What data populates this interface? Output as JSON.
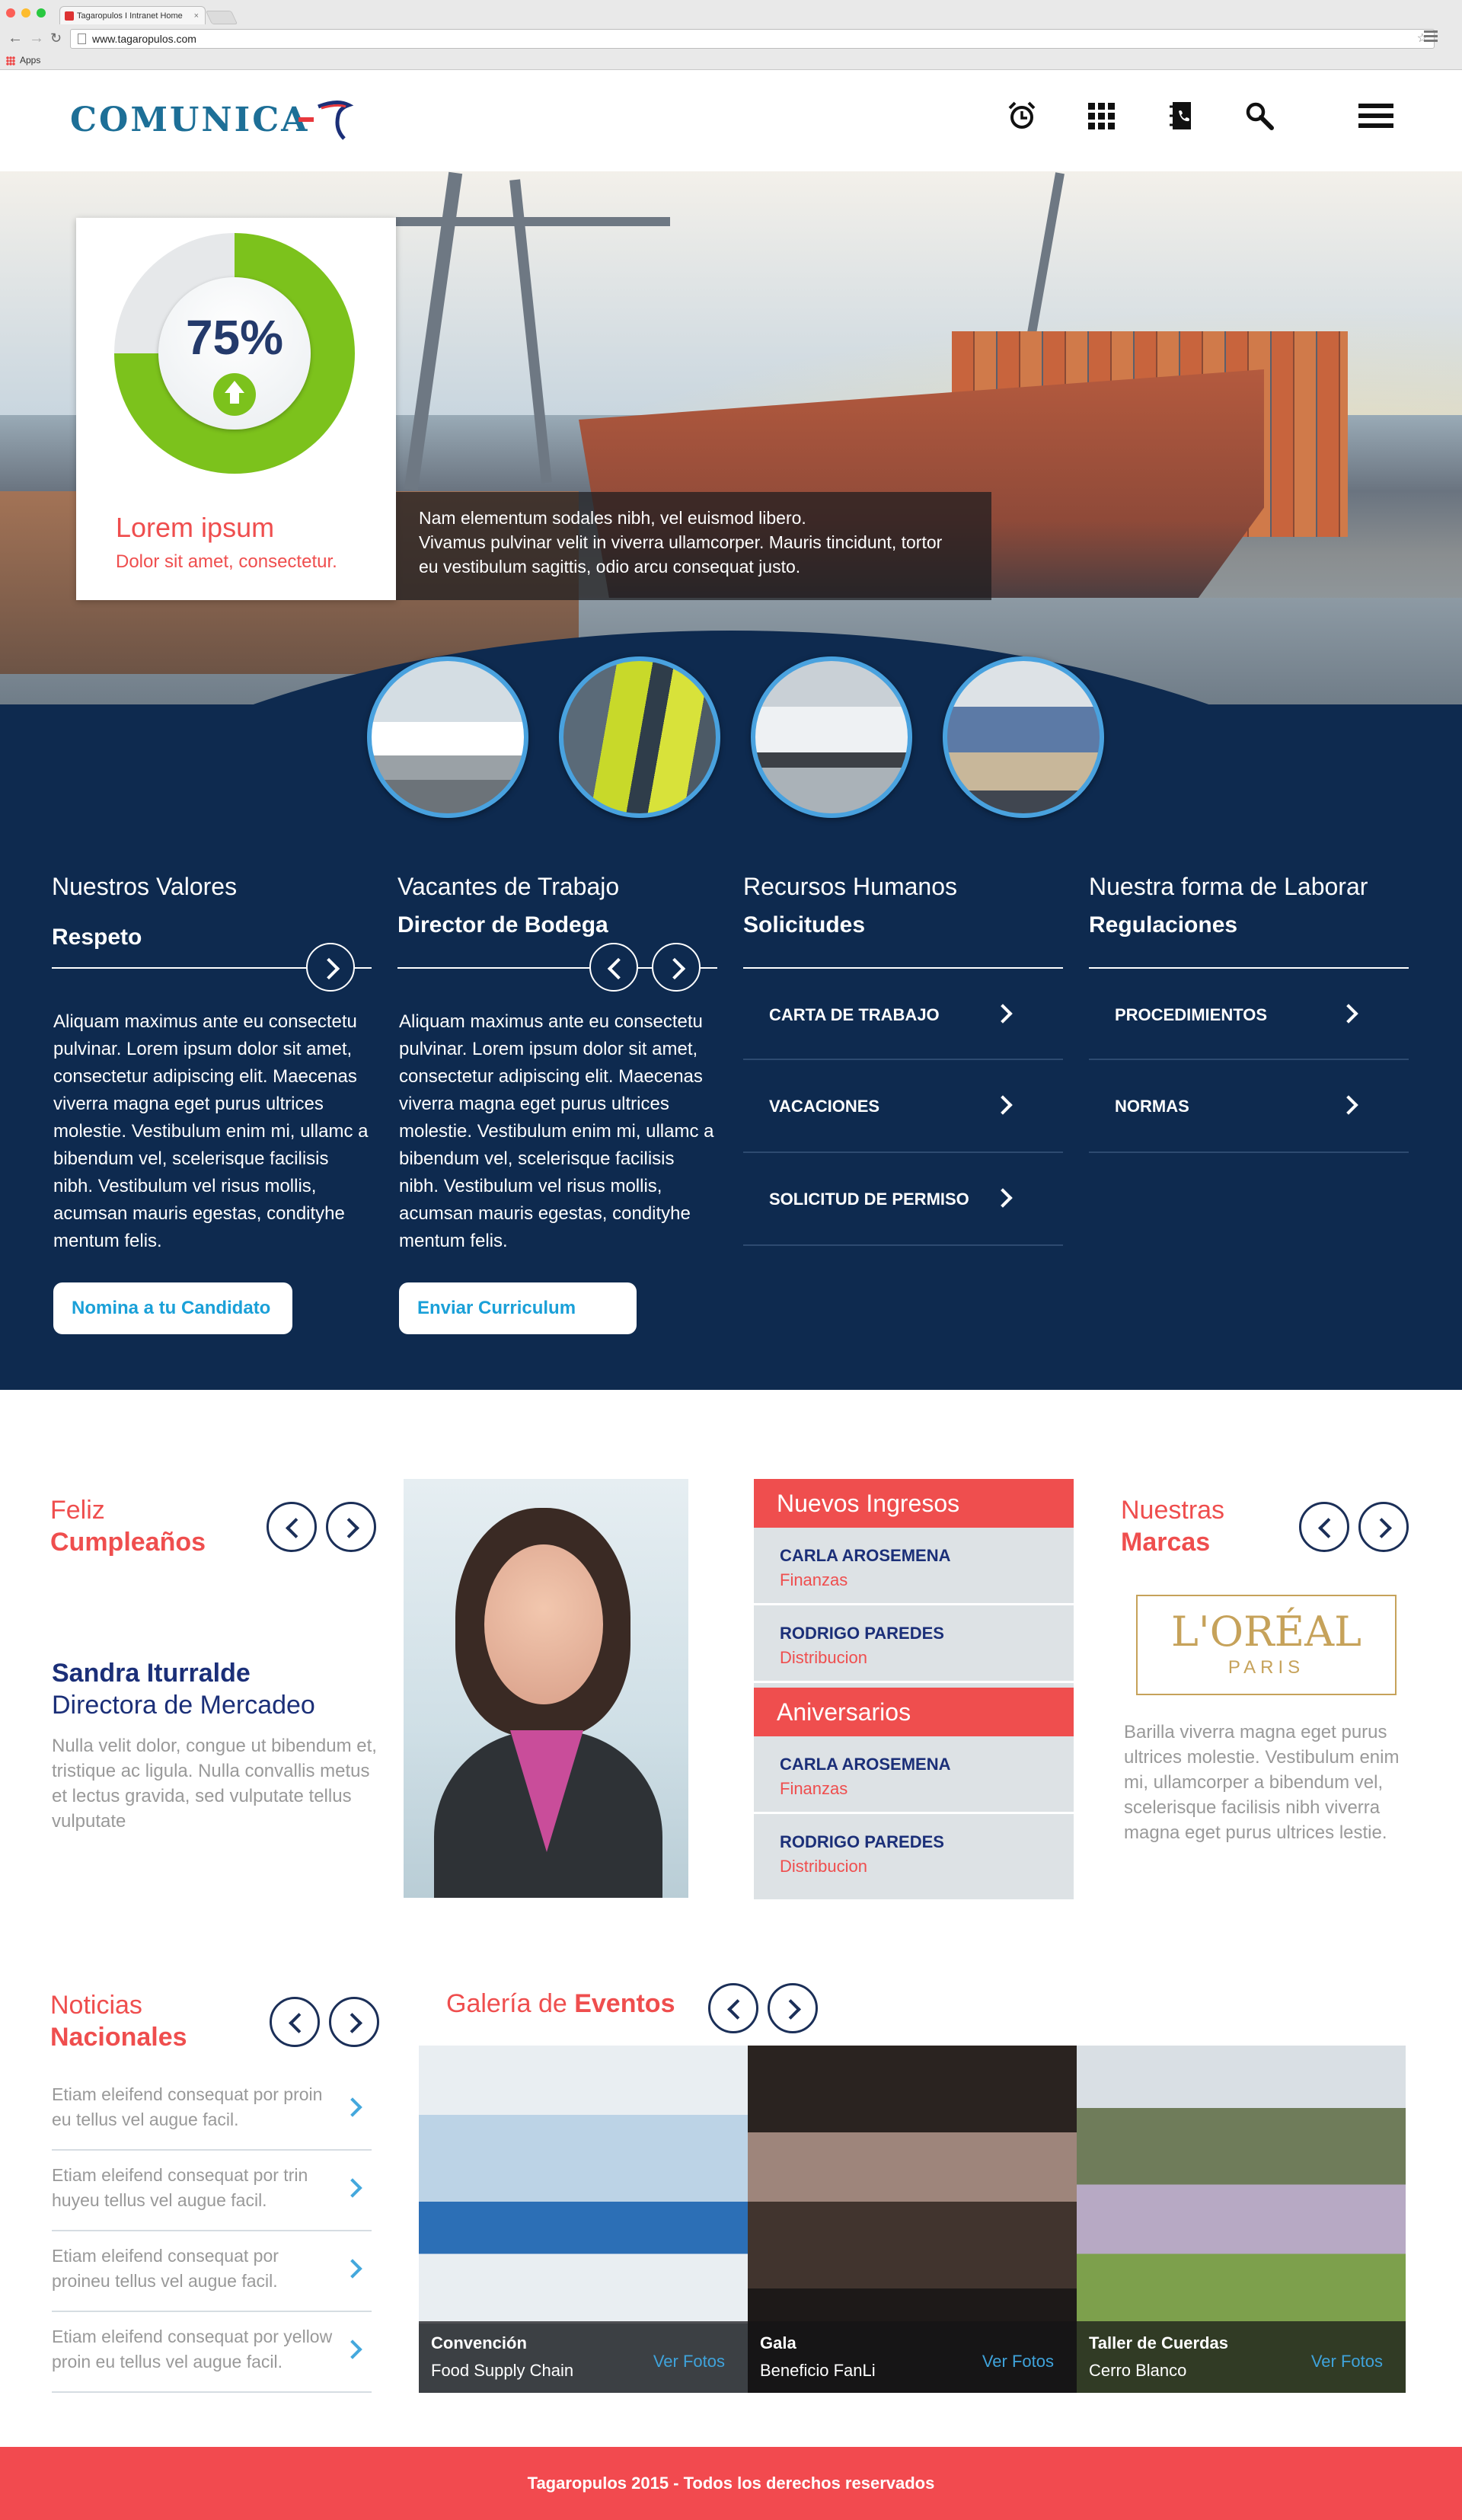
{
  "browser": {
    "tab_title": "Tagaropulos I Intranet Home",
    "url": "www.tagaropulos.com",
    "bookmarks_label": "Apps"
  },
  "header": {
    "logo_text": "COMUNICA",
    "icons": [
      "alarm-clock-icon",
      "grid-apps-icon",
      "phone-book-icon",
      "search-icon",
      "hamburger-menu-icon"
    ]
  },
  "hero": {
    "progress_percent": "75%",
    "progress_value": 0.75,
    "card_title": "Lorem ipsum",
    "card_subtitle": "Dolor sit amet, consectetur.",
    "caption_lines": [
      "Nam elementum sodales nibh, vel euismod libero.",
      "Vivamus pulvinar velit in viverra ullamcorper. Mauris tincidunt, tortor",
      "eu vestibulum sagittis, odio arcu consequat justo."
    ]
  },
  "columns": [
    {
      "category": "Nuestros Valores",
      "subtitle": "Respeto",
      "text": "Aliquam maximus ante eu consectetu pulvinar. Lorem ipsum dolor sit amet, consectetur adipiscing elit. Maecenas viverra magna eget purus ultrices molestie. Vestibulum enim mi, ullamc a bibendum vel, scelerisque facilisis nibh. Vestibulum vel risus mollis, acumsan mauris egestas, condityhe mentum felis.",
      "button": "Nomina a tu Candidato"
    },
    {
      "category": "Vacantes de Trabajo",
      "subtitle": "Director de Bodega",
      "text": "Aliquam maximus ante eu consectetu pulvinar. Lorem ipsum dolor sit amet, consectetur adipiscing elit. Maecenas viverra magna eget purus ultrices molestie. Vestibulum enim mi, ullamc a bibendum vel, scelerisque facilisis nibh. Vestibulum vel risus mollis, acumsan mauris egestas, condityhe mentum felis.",
      "button": "Enviar Curriculum"
    },
    {
      "category": "Recursos Humanos",
      "subtitle": "Solicitudes",
      "items": [
        "CARTA DE TRABAJO",
        "VACACIONES",
        "SOLICITUD DE PERMISO"
      ]
    },
    {
      "category": "Nuestra forma de Laborar",
      "subtitle": "Regulaciones",
      "items": [
        "PROCEDIMIENTOS",
        "NORMAS"
      ]
    }
  ],
  "birthday": {
    "title_light": "Feliz",
    "title_bold": "Cumpleaños",
    "name": "Sandra Iturralde",
    "role": "Directora de Mercadeo",
    "text": "Nulla velit dolor, congue ut bibendum et, tristique ac ligula. Nulla convallis metus et lectus gravida, sed vulputate tellus vulputate"
  },
  "new_hires": {
    "title": "Nuevos Ingresos",
    "items": [
      {
        "name": "CARLA AROSEMENA",
        "dept": "Finanzas"
      },
      {
        "name": "RODRIGO PAREDES",
        "dept": "Distribucion"
      }
    ]
  },
  "anniversaries": {
    "title": "Aniversarios",
    "items": [
      {
        "name": "CARLA AROSEMENA",
        "dept": "Finanzas"
      },
      {
        "name": "RODRIGO PAREDES",
        "dept": "Distribucion"
      }
    ]
  },
  "brands": {
    "title_light": "Nuestras",
    "title_bold": "Marcas",
    "logo_main": "L'ORÉAL",
    "logo_sub": "PARIS",
    "text": "Barilla  viverra magna eget purus ultrices molestie. Vestibulum enim mi, ullamcorper a bibendum vel, scelerisque facilisis nibh viverra magna eget purus ultrices lestie."
  },
  "news": {
    "title_light": "Noticias",
    "title_bold": "Nacionales",
    "items": [
      "Etiam eleifend consequat por proin eu tellus vel augue facil.",
      "Etiam eleifend consequat por trin huyeu tellus vel augue facil.",
      "Etiam eleifend consequat por proineu tellus vel augue facil.",
      "Etiam eleifend consequat por yellow proin eu tellus vel augue facil."
    ]
  },
  "gallery": {
    "title_light": "Galería de",
    "title_bold": "Eventos",
    "items": [
      {
        "title": "Convención",
        "subtitle": "Food Supply Chain",
        "link": "Ver Fotos"
      },
      {
        "title": "Gala",
        "subtitle": "Beneficio FanLi",
        "link": "Ver Fotos"
      },
      {
        "title": "Taller de Cuerdas",
        "subtitle": "Cerro Blanco",
        "link": "Ver Fotos"
      }
    ]
  },
  "footer": {
    "text": "Tagaropulos 2015 - Todos los derechos reservados"
  },
  "colors": {
    "navy": "#0e2a4f",
    "accent_red": "#ef4e4e",
    "green": "#7cc21c",
    "link_blue": "#1aa0d8"
  }
}
